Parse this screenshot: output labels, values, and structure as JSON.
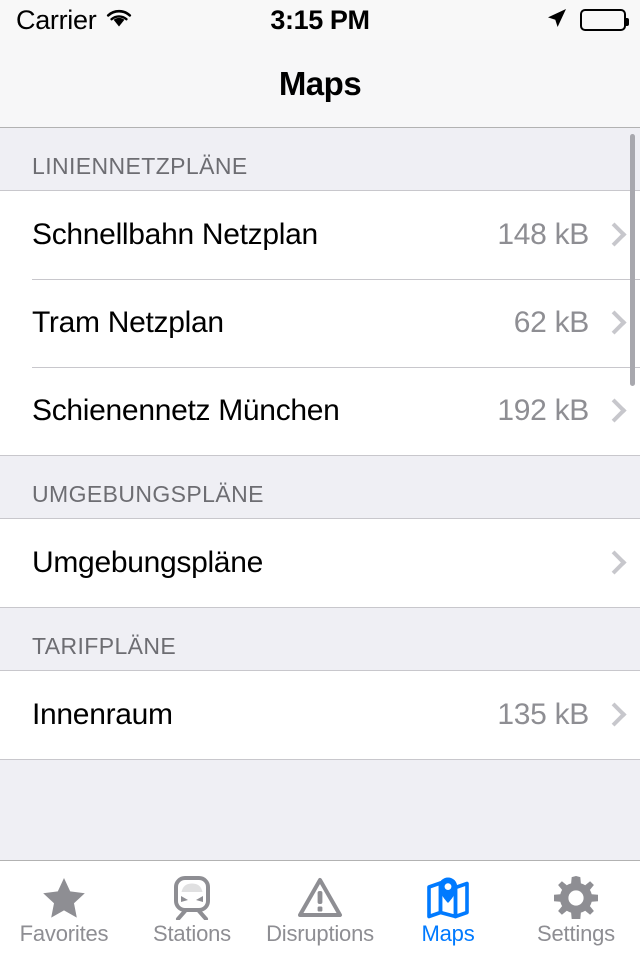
{
  "status_bar": {
    "carrier": "Carrier",
    "wifi_icon": "wifi-icon",
    "time": "3:15 PM",
    "location_icon": "location-arrow-icon",
    "battery_icon": "battery-full-icon"
  },
  "nav_bar": {
    "title": "Maps"
  },
  "sections": [
    {
      "header": "LINIENNETZPLÄNE",
      "rows": [
        {
          "title": "Schnellbahn Netzplan",
          "size": "148 kB"
        },
        {
          "title": "Tram Netzplan",
          "size": "62 kB"
        },
        {
          "title": "Schienennetz München",
          "size": "192 kB"
        }
      ]
    },
    {
      "header": "UMGEBUNGSPLÄNE",
      "rows": [
        {
          "title": "Umgebungspläne",
          "size": ""
        }
      ]
    },
    {
      "header": "TARIFPLÄNE",
      "rows": [
        {
          "title": "Innenraum",
          "size": "135 kB"
        }
      ]
    }
  ],
  "tab_bar": {
    "active_color": "#007aff",
    "inactive_color": "#8e8e93",
    "tabs": [
      {
        "label": "Favorites",
        "icon": "star-icon",
        "active": false
      },
      {
        "label": "Stations",
        "icon": "train-icon",
        "active": false
      },
      {
        "label": "Disruptions",
        "icon": "warning-icon",
        "active": false
      },
      {
        "label": "Maps",
        "icon": "map-pin-icon",
        "active": true
      },
      {
        "label": "Settings",
        "icon": "gear-icon",
        "active": false
      }
    ]
  }
}
